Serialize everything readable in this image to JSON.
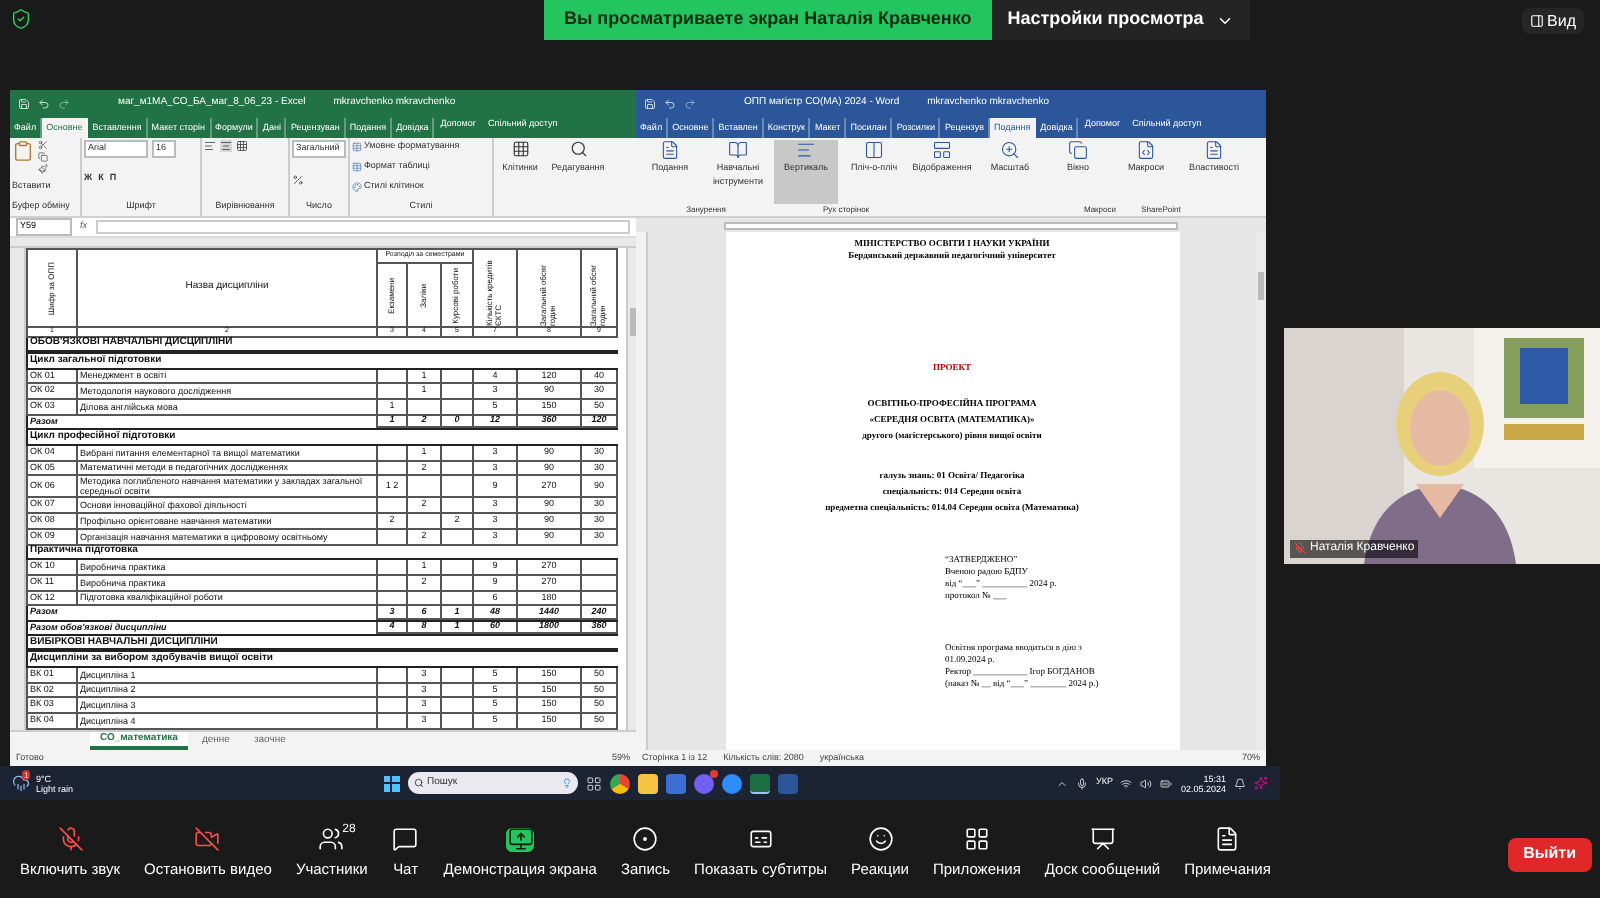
{
  "zoom_top": {
    "sharing_banner": "Вы просматриваете экран Наталія Кравченко",
    "view_options": "Настройки просмотра",
    "view_button": "Вид"
  },
  "excel": {
    "title": "маг_м1МА_СО_БА_маг_8_06_23  -  Excel",
    "user": "mkravchenko mkravchenko",
    "tabs": [
      {
        "label": "Файл",
        "selected": false
      },
      {
        "label": "Основне",
        "selected": true
      },
      {
        "label": "Вставлення",
        "selected": false
      },
      {
        "label": "Макет сторін",
        "selected": false
      },
      {
        "label": "Формули",
        "selected": false
      },
      {
        "label": "Дані",
        "selected": false
      },
      {
        "label": "Рецензуван",
        "selected": false
      },
      {
        "label": "Подання",
        "selected": false
      },
      {
        "label": "Довідка",
        "selected": false
      }
    ],
    "help": "Допомог",
    "share": "Спільний доступ",
    "ribbon": {
      "paste": "Вставити",
      "font": "Arial",
      "size": "16",
      "format_letters": [
        "Ж",
        "К",
        "П"
      ],
      "number_format": "Загальний",
      "styles": [
        "Умовне форматування",
        "Формат таблиці",
        "Стилі клітинок"
      ],
      "cells": "Клітинки",
      "editing": "Редагування",
      "groups": [
        "Буфер обміну",
        "Шрифт",
        "Вирівнювання",
        "Число",
        "Стилі"
      ]
    },
    "name_box": "Y59",
    "fx": "fx",
    "header": {
      "code": "Шифр за ОПП",
      "name": "Назва дисципліни",
      "semesters": "Розподіл за семестрами",
      "sub": [
        "Екзамени",
        "Заліки",
        "Курсові роботи"
      ],
      "credits": "Кількість кредитів ЄКТС",
      "hours": "Загальний обсяг годин",
      "last": "Загальний обсяг годин",
      "numbers": [
        "1",
        "2",
        "3",
        "4",
        "5",
        "7",
        "8",
        "9"
      ]
    },
    "rows": [
      {
        "kind": "section",
        "label": "ОБОВ'ЯЗКОВІ  НАВЧАЛЬНІ ДИСЦИПЛІНИ"
      },
      {
        "kind": "subsection",
        "label": "Цикл загальної підготовки"
      },
      {
        "kind": "item",
        "code": "ОК 01",
        "name": "Менеджмент в освіті",
        "values": {
          "tests": "1",
          "credits": "4",
          "hours": "120",
          "last": "40"
        }
      },
      {
        "kind": "item",
        "code": "ОК 02",
        "name": "Методологія наукового дослідження",
        "values": {
          "tests": "1",
          "credits": "3",
          "hours": "90",
          "last": "30"
        }
      },
      {
        "kind": "item",
        "code": "ОК 03",
        "name": "Ділова англійська мова",
        "values": {
          "exams": "1",
          "credits": "5",
          "hours": "150",
          "last": "50"
        }
      },
      {
        "kind": "total",
        "label": "Разом",
        "values": {
          "exams": "1",
          "tests": "2",
          "coursework": "0",
          "credits": "12",
          "hours": "360",
          "last": "120"
        }
      },
      {
        "kind": "subsection",
        "label": "Цикл професійної підготовки"
      },
      {
        "kind": "item",
        "code": "ОК 04",
        "name": "Вибрані питання елементарної та вищої математики",
        "values": {
          "tests": "1",
          "credits": "3",
          "hours": "90",
          "last": "30"
        }
      },
      {
        "kind": "item",
        "code": "ОК 05",
        "name": "Математичні методи в педагогічних дослідженнях",
        "values": {
          "tests": "2",
          "credits": "3",
          "hours": "90",
          "last": "30"
        }
      },
      {
        "kind": "item",
        "code": "ОК 06",
        "name": "Методика поглибленого навчання математики у закладах загальної середньої освіти",
        "values": {
          "exams": "1 2",
          "credits": "9",
          "hours": "270",
          "last": "90"
        }
      },
      {
        "kind": "item",
        "code": "ОК 07",
        "name": "Основи інноваційної фахової діяльності",
        "values": {
          "tests": "2",
          "credits": "3",
          "hours": "90",
          "last": "30"
        }
      },
      {
        "kind": "item",
        "code": "ОК 08",
        "name": "Профільно орієнтоване навчання математики",
        "values": {
          "exams": "2",
          "coursework": "2",
          "credits": "3",
          "hours": "90",
          "last": "30"
        }
      },
      {
        "kind": "item",
        "code": "ОК 09",
        "name": "Організація навчання математики в цифровому освітньому",
        "values": {
          "tests": "2",
          "credits": "3",
          "hours": "90",
          "last": "30"
        }
      },
      {
        "kind": "subsection",
        "label": "Практична підготовка"
      },
      {
        "kind": "item",
        "code": "ОК 10",
        "name": "Виробнича практика",
        "values": {
          "tests": "1",
          "credits": "9",
          "hours": "270"
        }
      },
      {
        "kind": "item",
        "code": "ОК 11",
        "name": "Виробнича практика",
        "values": {
          "tests": "2",
          "credits": "9",
          "hours": "270"
        }
      },
      {
        "kind": "item",
        "code": "ОК 12",
        "name": "Підготовка кваліфікаційної роботи",
        "values": {
          "credits": "6",
          "hours": "180"
        }
      },
      {
        "kind": "total",
        "label": "Разом",
        "values": {
          "exams": "3",
          "tests": "6",
          "coursework": "1",
          "credits": "48",
          "hours": "1440",
          "last": "240"
        }
      },
      {
        "kind": "total",
        "label": "Разом обов'язкові дисципліни",
        "values": {
          "exams": "4",
          "tests": "8",
          "coursework": "1",
          "credits": "60",
          "hours": "1800",
          "last": "360"
        }
      },
      {
        "kind": "section",
        "label": "ВИБІРКОВІ НАВЧАЛЬНІ ДИСЦИПЛІНИ"
      },
      {
        "kind": "subsection",
        "label": "Дисципліни за вибором здобувачів вищої освіти"
      },
      {
        "kind": "item",
        "code": "ВК 01",
        "name": "Дисципліна 1",
        "values": {
          "tests": "3",
          "credits": "5",
          "hours": "150",
          "last": "50"
        }
      },
      {
        "kind": "item",
        "code": "ВК 02",
        "name": "Дисципліна 2",
        "values": {
          "tests": "3",
          "credits": "5",
          "hours": "150",
          "last": "50"
        }
      },
      {
        "kind": "item",
        "code": "ВК 03",
        "name": "Дисципліна 3",
        "values": {
          "tests": "3",
          "credits": "5",
          "hours": "150",
          "last": "50"
        }
      },
      {
        "kind": "item",
        "code": "ВК 04",
        "name": "Дисципліна 4",
        "values": {
          "tests": "3",
          "credits": "5",
          "hours": "150",
          "last": "50"
        }
      }
    ],
    "sheet_tabs": [
      {
        "label": "СО_математика",
        "selected": true
      },
      {
        "label": "денне",
        "selected": false
      },
      {
        "label": "заочне",
        "selected": false
      }
    ],
    "status": "Готово",
    "zoom": "59%"
  },
  "word": {
    "title": "ОПП магістр СО(МА) 2024  -  Word",
    "user": "mkravchenko mkravchenko",
    "tabs": [
      {
        "label": "Файл",
        "selected": false
      },
      {
        "label": "Основне",
        "selected": false
      },
      {
        "label": "Вставлен",
        "selected": false
      },
      {
        "label": "Конструк",
        "selected": false
      },
      {
        "label": "Макет",
        "selected": false
      },
      {
        "label": "Посилан",
        "selected": false
      },
      {
        "label": "Розсилки",
        "selected": false
      },
      {
        "label": "Рецензув",
        "selected": false
      },
      {
        "label": "Подання",
        "selected": true
      },
      {
        "label": "Довідка",
        "selected": false
      }
    ],
    "help": "Допомог",
    "share": "Спільний доступ",
    "ribbon": {
      "buttons": [
        {
          "label": "Подання",
          "selected": false
        },
        {
          "label": "Навчальні інструменти",
          "selected": false
        },
        {
          "label": "Вертикаль",
          "selected": true
        },
        {
          "label": "Пліч-о-пліч",
          "selected": false
        },
        {
          "label": "Відображення",
          "selected": false
        },
        {
          "label": "Масштаб",
          "selected": false
        },
        {
          "label": "Вікно",
          "selected": false
        },
        {
          "label": "Макроси",
          "selected": false
        },
        {
          "label": "Властивості",
          "selected": false
        }
      ],
      "groups": [
        "Занурення",
        "Рух сторінок",
        "Макроси",
        "SharePoint"
      ]
    },
    "document": [
      {
        "kind": "heading",
        "lines": [
          "МІНІСТЕРСТВО ОСВІТИ І НАУКИ УКРАЇНИ",
          "Бердянський державний педагогічний університет"
        ]
      },
      {
        "kind": "stamp",
        "lines": [
          "ПРОЕКТ"
        ]
      },
      {
        "kind": "title",
        "lines": [
          "ОСВІТНЬО-ПРОФЕСІЙНА ПРОГРАМА",
          "«СЕРЕДНЯ ОСВІТА (МАТЕМАТИКА)»",
          "другого (магістерського) рівня вищої освіти"
        ]
      },
      {
        "kind": "field",
        "lines": [
          "галузь знань: 01 Освіта/ Педагогіка",
          "спеціальність: 014 Середня освіта",
          "предметна спеціальність: 014.04 Середня освіта (Математика)"
        ]
      },
      {
        "kind": "approval",
        "lines": [
          "“ЗАТВЕРДЖЕНО”",
          "Вченою радою БДПУ",
          "від “___” __________ 2024 р.",
          "протокол № ___"
        ]
      },
      {
        "kind": "approval",
        "lines": [
          "Освітня програма вводиться в дію з",
          "01.09.2024 р.",
          "Ректор ____________ Ігор БОГДАНОВ",
          "(наказ № __ від “___” ________ 2024 р.)"
        ]
      }
    ],
    "status": [
      "Сторінка 1 із 12",
      "Кількість слів: 2080",
      "українська"
    ],
    "zoom": "70%"
  },
  "taskbar": {
    "temperature": "9°C",
    "weather": "Light rain",
    "weather_badge": "1",
    "search": "Пошук",
    "language": "УКР",
    "time": "15:31",
    "date": "02.05.2024"
  },
  "video_tile": {
    "name": "Наталія Кравченко",
    "muted": true
  },
  "toolbar": {
    "items": [
      {
        "kind": "mic_off",
        "label": "Включить звук"
      },
      {
        "kind": "video_off",
        "label": "Остановить видео"
      },
      {
        "kind": "participants",
        "label": "Участники",
        "badge": "28"
      },
      {
        "kind": "chat",
        "label": "Чат"
      },
      {
        "kind": "share",
        "label": "Демонстрация экрана"
      },
      {
        "kind": "record",
        "label": "Запись"
      },
      {
        "kind": "captions",
        "label": "Показать субтитры"
      },
      {
        "kind": "reactions",
        "label": "Реакции"
      },
      {
        "kind": "apps",
        "label": "Приложения"
      },
      {
        "kind": "whiteboard",
        "label": "Доск сообщений"
      },
      {
        "kind": "notes",
        "label": "Примечания"
      }
    ],
    "leave": "Выйти"
  }
}
